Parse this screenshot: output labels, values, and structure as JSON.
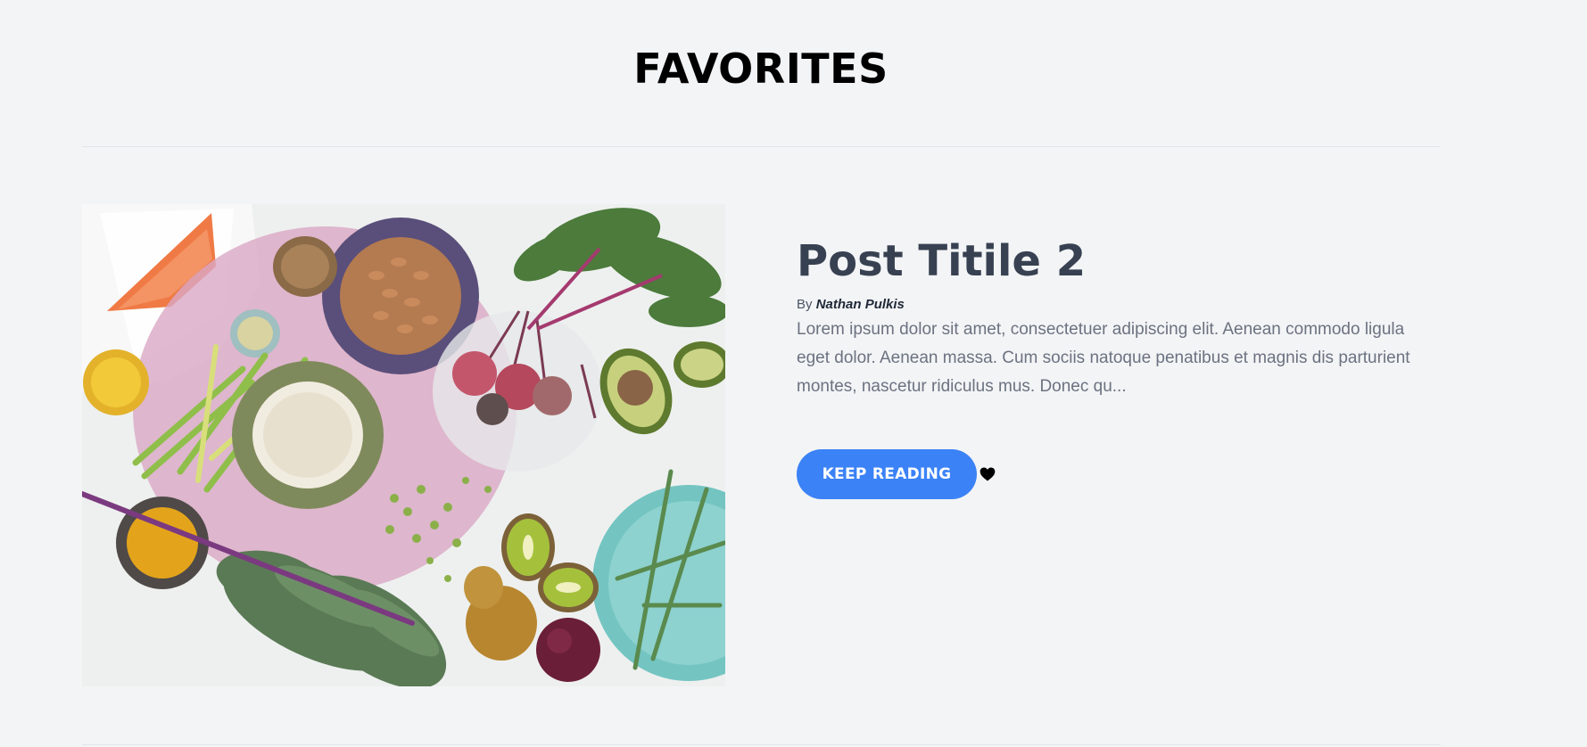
{
  "header": {
    "title": "FAVORITES"
  },
  "post": {
    "title": "Post Titile 2",
    "byline_prefix": "By",
    "author": "Nathan Pulkis",
    "excerpt": "Lorem ipsum dolor sit amet, consectetuer adipiscing elit. Aenean commodo ligula eget dolor. Aenean massa. Cum sociis natoque penatibus et magnis dis parturient montes, nascetur ridiculus mus. Donec qu...",
    "button_label": "KEEP READING",
    "image_icon": "food-photo",
    "favorite_icon": "heart-icon"
  },
  "colors": {
    "background": "#f3f4f6",
    "accent": "#3b82f6",
    "title_text": "#374151",
    "body_text": "#6b7280"
  }
}
